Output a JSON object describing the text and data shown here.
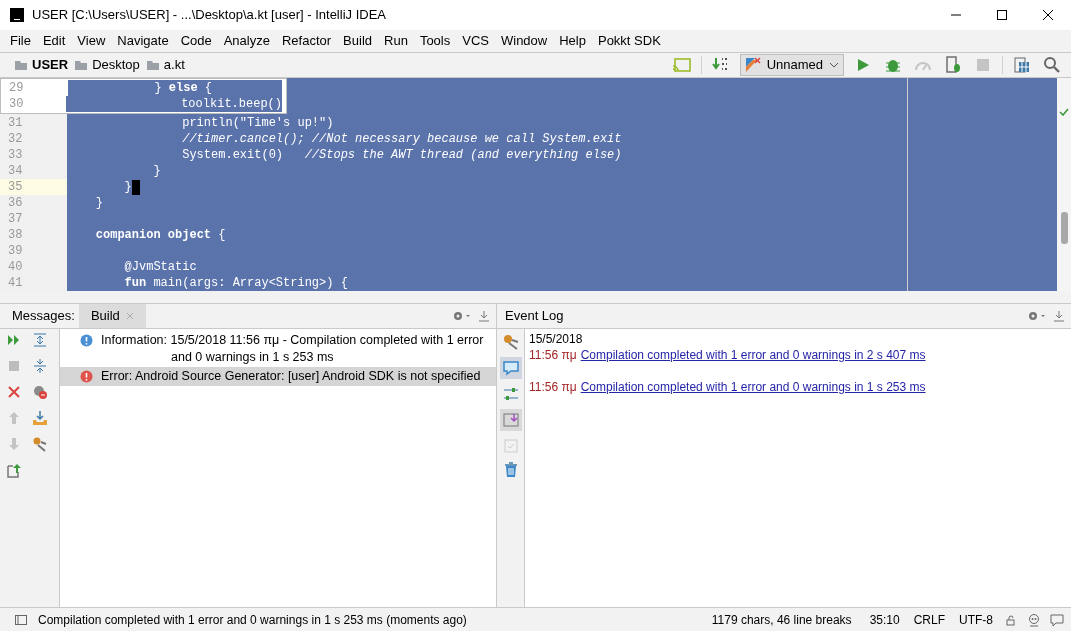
{
  "window": {
    "title": "USER [C:\\Users\\USER] - ...\\Desktop\\a.kt [user] - IntelliJ IDEA"
  },
  "menu": [
    "File",
    "Edit",
    "View",
    "Navigate",
    "Code",
    "Analyze",
    "Refactor",
    "Build",
    "Run",
    "Tools",
    "VCS",
    "Window",
    "Help",
    "Pokkt SDK"
  ],
  "breadcrumbs": [
    "USER",
    "Desktop",
    "a.kt"
  ],
  "toolbar": {
    "run_configuration": "Unnamed",
    "tools": [
      {
        "kind": "cast",
        "disabled": false
      },
      {
        "kind": "binary",
        "disabled": false
      },
      {
        "kind": "config"
      },
      {
        "kind": "run",
        "disabled": false
      },
      {
        "kind": "debug",
        "disabled": false
      },
      {
        "kind": "profile",
        "disabled": true
      },
      {
        "kind": "attach",
        "disabled": false
      },
      {
        "kind": "stop",
        "disabled": true
      },
      {
        "kind": "structure",
        "disabled": false
      },
      {
        "kind": "search",
        "disabled": false
      }
    ]
  },
  "sticky_lines": [
    {
      "number": "29",
      "text": "            } **else** {"
    },
    {
      "number": "30",
      "text": "                toolkit.beep()"
    }
  ],
  "editor_lines": [
    {
      "number": "31",
      "text": "                println(\"Time's up!\")",
      "kind": "code",
      "current": false
    },
    {
      "number": "32",
      "text": "                //timer.cancel(); //Not necessary because we call System.exit",
      "kind": "comment",
      "current": false
    },
    {
      "number": "33",
      "text": "                System.exit(0)   *//Stops the AWT thread (and everything else)*",
      "kind": "code",
      "current": false
    },
    {
      "number": "34",
      "text": "            }",
      "kind": "code",
      "current": false
    },
    {
      "number": "35",
      "text": "        }",
      "kind": "code",
      "current": true
    },
    {
      "number": "36",
      "text": "    }",
      "kind": "code",
      "current": false
    },
    {
      "number": "37",
      "current": false
    },
    {
      "number": "38",
      "text": "    **companion object** {",
      "kind": "code",
      "current": false
    },
    {
      "number": "39",
      "current": false
    },
    {
      "number": "40",
      "text": "        @JvmStatic",
      "kind": "code",
      "current": false
    },
    {
      "number": "41",
      "text": "        **fun** main(args: Array<String>) {",
      "kind": "code",
      "current": false
    }
  ],
  "messages": {
    "label": "Messages:",
    "tabs": [
      {
        "label": "Build",
        "selected": true
      }
    ],
    "rows": [
      {
        "kind": "info",
        "lines": [
          "Information: 15/5/2018 11:56 πμ - Compilation completed with 1 error",
          "and 0 warnings in 1 s 253 ms"
        ],
        "selected": false
      },
      {
        "kind": "error",
        "lines": [
          "Error: Android Source Generator: [user] Android SDK is not specified"
        ],
        "selected": true
      }
    ]
  },
  "event_log": {
    "title": "Event Log",
    "date": "15/5/2018",
    "entries": [
      {
        "time": "11:56 πμ",
        "message": "Compilation completed with 1 error and 0 warnings in 2 s 407 ms"
      },
      {
        "time": "11:56 πμ",
        "message": "Compilation completed with 1 error and 0 warnings in 1 s 253 ms"
      }
    ]
  },
  "status_bar": {
    "message": "Compilation completed with 1 error and 0 warnings in 1 s 253 ms (moments ago)",
    "chars": "1179 chars, 46 line breaks",
    "position": "35:10",
    "line_separator": "CRLF",
    "encoding": "UTF-8"
  }
}
